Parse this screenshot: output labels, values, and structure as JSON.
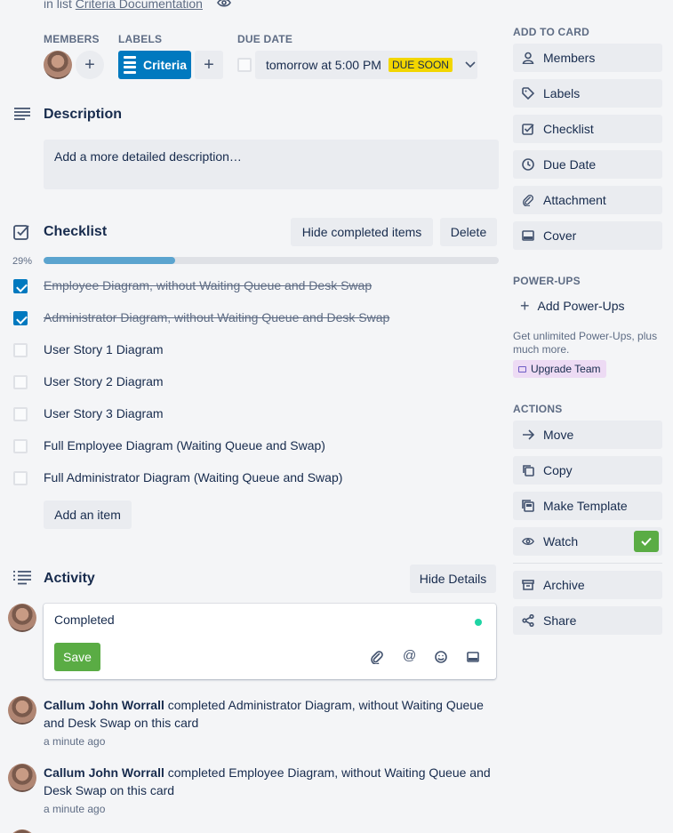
{
  "header": {
    "in_list_prefix": "in list",
    "list_name": "Criteria Documentation"
  },
  "meta": {
    "members_label": "MEMBERS",
    "labels_label": "LABELS",
    "due_label": "DUE DATE",
    "label_name": "Criteria",
    "due_text": "tomorrow at 5:00 PM",
    "due_badge": "DUE SOON"
  },
  "description": {
    "title": "Description",
    "placeholder": "Add a more detailed description…"
  },
  "checklist": {
    "title": "Checklist",
    "hide_completed": "Hide completed items",
    "delete": "Delete",
    "percent_text": "29%",
    "progress": 0.29,
    "items": [
      {
        "text": "Employee Diagram, without Waiting Queue and Desk Swap",
        "done": true
      },
      {
        "text": "Administrator Diagram, without Waiting Queue and Desk Swap",
        "done": true
      },
      {
        "text": "User Story 1 Diagram",
        "done": false
      },
      {
        "text": "User Story 2 Diagram",
        "done": false
      },
      {
        "text": "User Story 3 Diagram",
        "done": false
      },
      {
        "text": "Full Employee Diagram (Waiting Queue and Swap)",
        "done": false
      },
      {
        "text": "Full Administrator Diagram (Waiting Queue and Swap)",
        "done": false
      }
    ],
    "add_item": "Add an item"
  },
  "activity": {
    "title": "Activity",
    "hide_details": "Hide Details",
    "comment_value": "Completed",
    "save": "Save",
    "entries": [
      {
        "user": "Callum John Worrall",
        "text": " completed Administrator Diagram, without Waiting Queue and Desk Swap on this card",
        "time": "a minute ago"
      },
      {
        "user": "Callum John Worrall",
        "text": " completed Employee Diagram, without Waiting Queue and Desk Swap on this card",
        "time": "a minute ago"
      }
    ]
  },
  "sidebar": {
    "add_to_card_title": "ADD TO CARD",
    "add_to_card": [
      {
        "label": "Members",
        "icon": "person-icon"
      },
      {
        "label": "Labels",
        "icon": "tag-icon"
      },
      {
        "label": "Checklist",
        "icon": "checklist-icon"
      },
      {
        "label": "Due Date",
        "icon": "clock-icon"
      },
      {
        "label": "Attachment",
        "icon": "paperclip-icon"
      },
      {
        "label": "Cover",
        "icon": "cover-icon"
      }
    ],
    "powerups_title": "POWER-UPS",
    "add_powerups": "Add Power-Ups",
    "powerups_note": "Get unlimited Power-Ups, plus much more.",
    "upgrade": "Upgrade Team",
    "actions_title": "ACTIONS",
    "actions": [
      {
        "label": "Move",
        "icon": "arrow-right-icon"
      },
      {
        "label": "Copy",
        "icon": "copy-icon"
      },
      {
        "label": "Make Template",
        "icon": "template-icon"
      },
      {
        "label": "Watch",
        "icon": "eye-icon"
      },
      {
        "label": "Archive",
        "icon": "archive-icon"
      },
      {
        "label": "Share",
        "icon": "share-icon"
      }
    ]
  },
  "colors": {
    "accent": "#0079bf",
    "save": "#5aac44",
    "due_soon": "#f2d600",
    "progress": "#5ba4cf",
    "watch_check": "#5aac44"
  }
}
